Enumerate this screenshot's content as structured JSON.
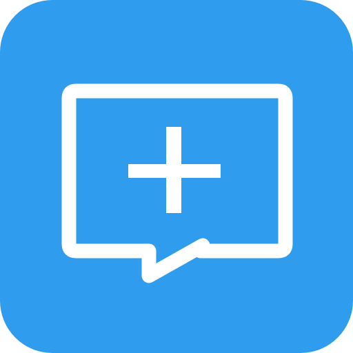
{
  "icon": {
    "name": "new-message-icon",
    "glyph": "chat-bubble-plus",
    "colors": {
      "background": "#2f9ced",
      "foreground": "#ffffff"
    }
  }
}
